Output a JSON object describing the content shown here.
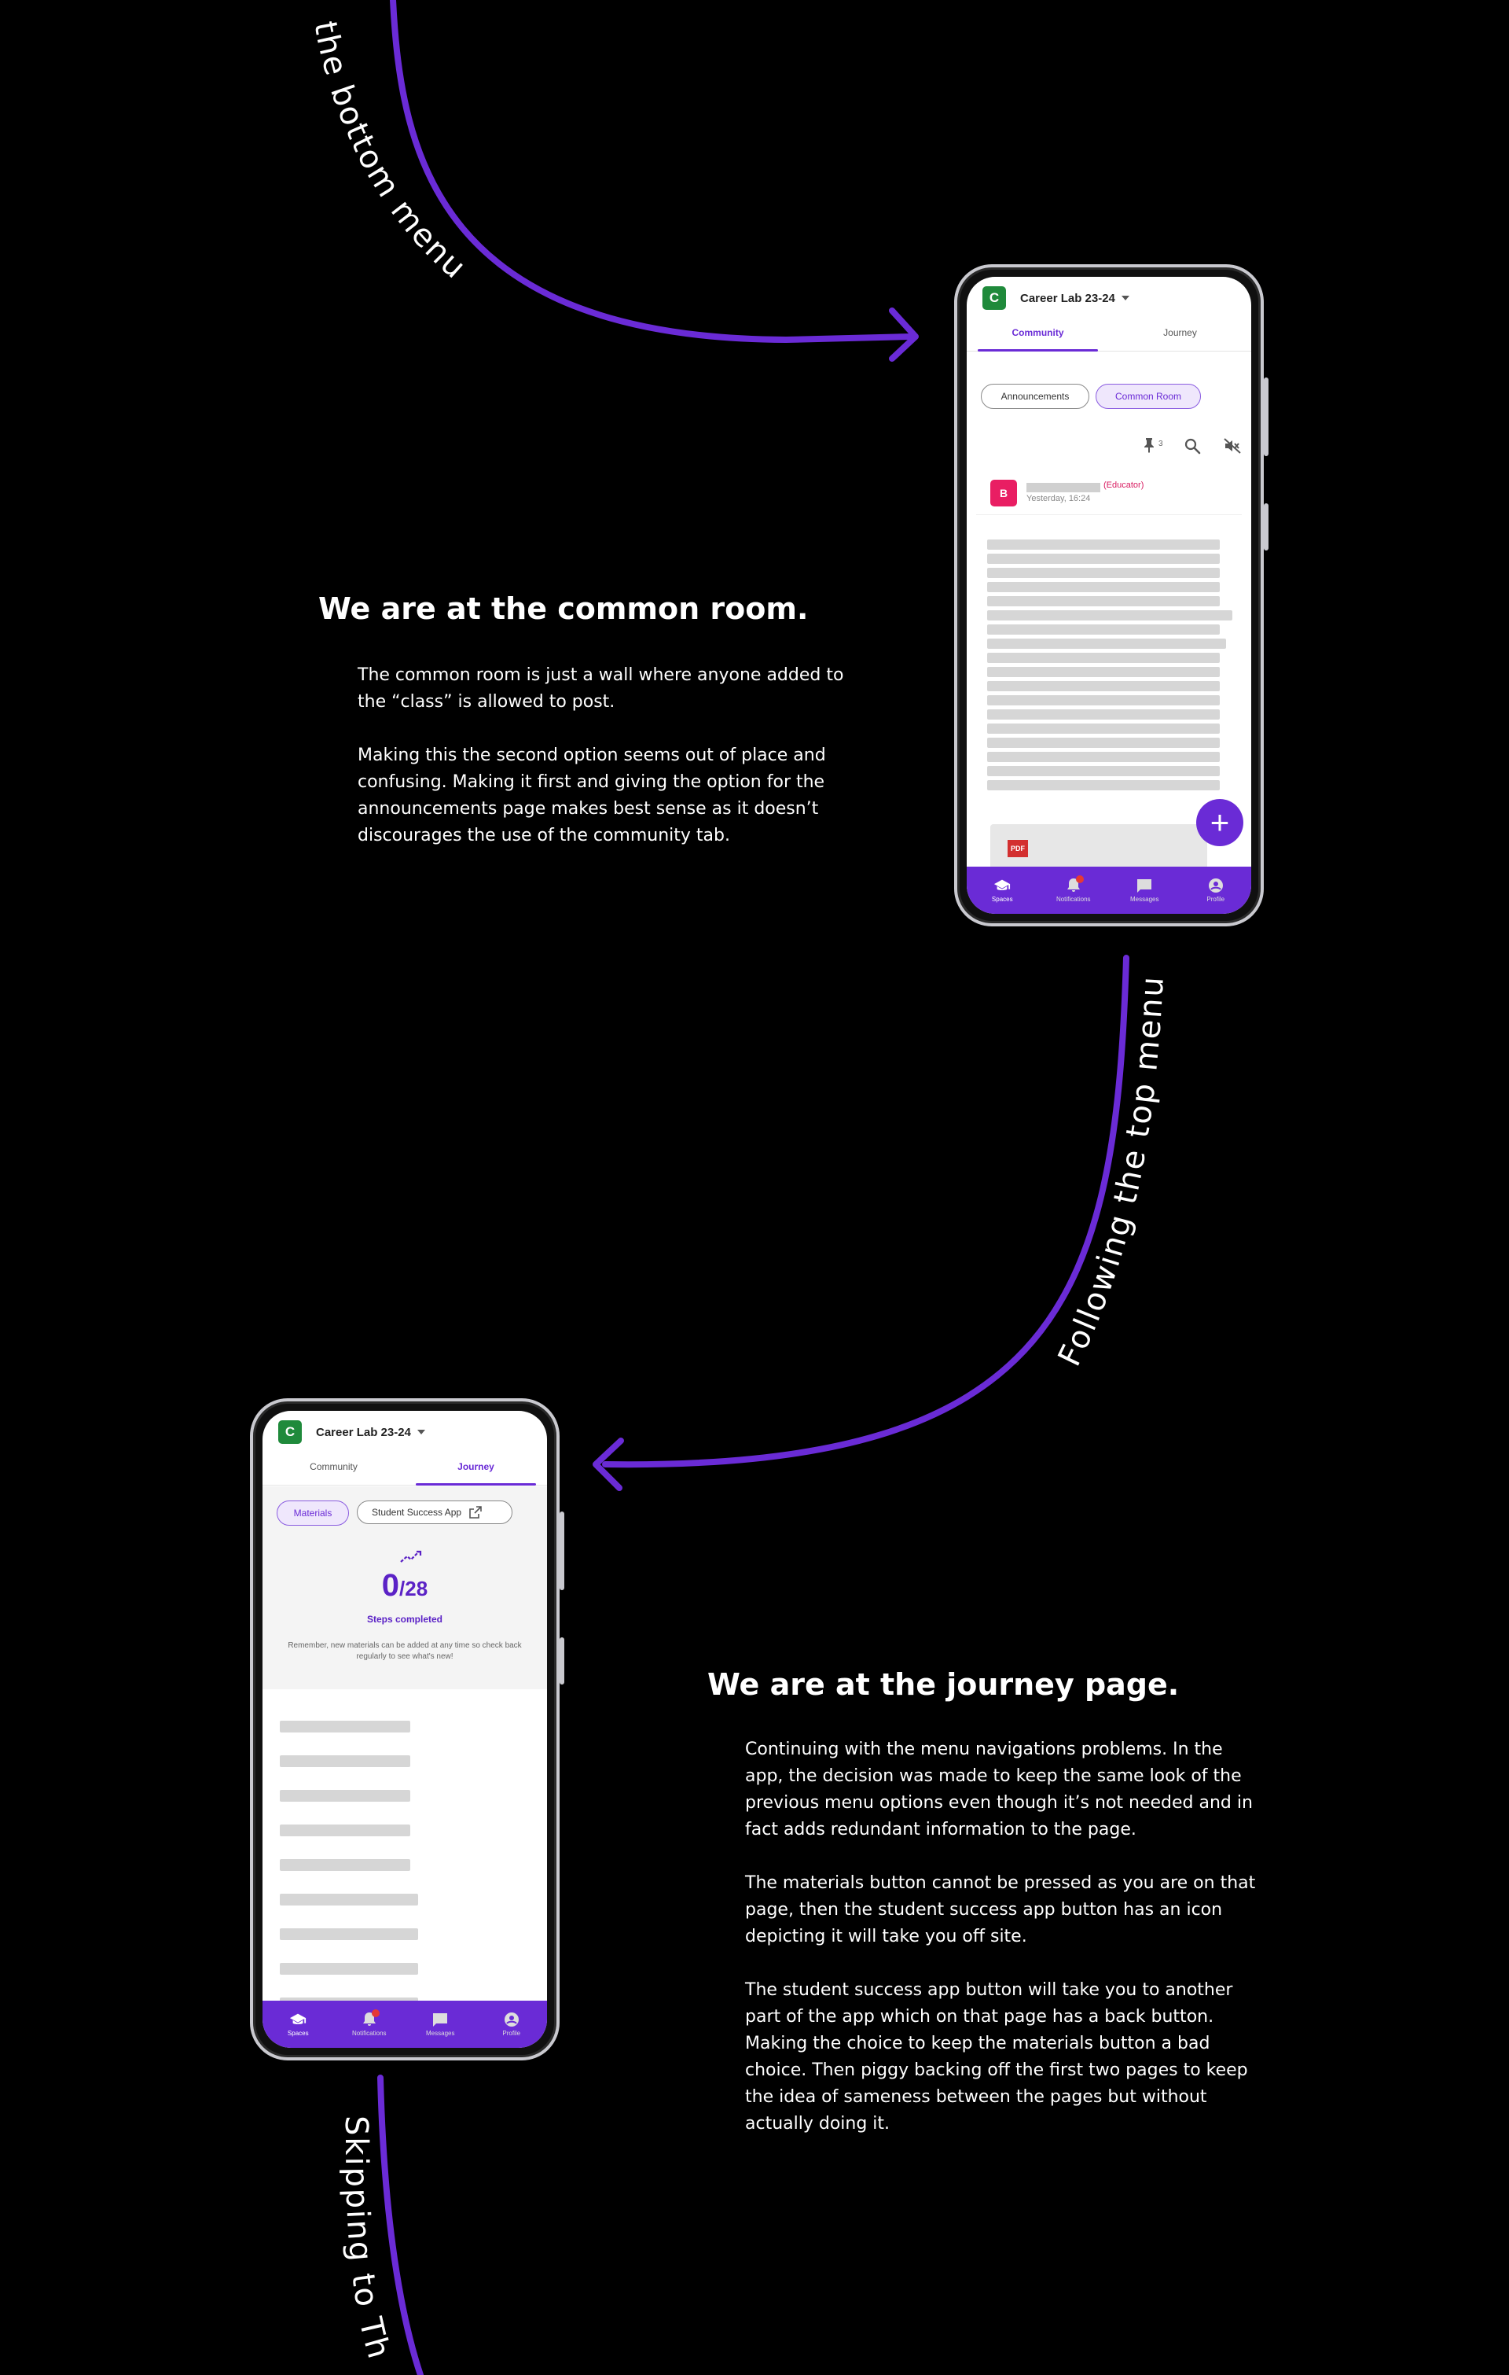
{
  "flow_labels": {
    "top_arc": "the  bottom  menu",
    "right_arc": "Following  the  top  menu",
    "bottom_arc": "Skipping  to  The"
  },
  "section1": {
    "heading": "We are at the common room.",
    "paragraphs": [
      "The common room is just a wall where anyone added to the “class” is allowed to post.",
      "Making this the second option seems out of place and confusing. Making it first and giving the option for the announcements  page makes best sense as it doesn’t discourages the use of the community tab."
    ]
  },
  "section2": {
    "heading": "We are at the journey page.",
    "paragraphs": [
      "Continuing with the menu navigations problems. In the app, the decision was made to keep the same look of the previous menu options even though it’s not needed and in fact adds redundant information to the page.",
      "The materials button cannot be pressed as you are on that page, then the student success app button has an icon depicting it will take you off site.",
      "The student success app button will take you to another part of the app which on that page has a back button. Making the choice to keep the materials button a bad choice. Then piggy backing off the first two pages to keep the idea of sameness between the pages but without actually doing it."
    ]
  },
  "phone1": {
    "space_avatar_letter": "C",
    "space_title": "Career Lab 23-24",
    "tabs": [
      "Community",
      "Journey"
    ],
    "active_tab": "Community",
    "chips": [
      "Announcements",
      "Common Room"
    ],
    "selected_chip": "Common Room",
    "pinned_count": "3",
    "post": {
      "avatar_letter": "B",
      "role": "(Educator)",
      "time": "Yesterday, 16:24"
    },
    "attachment_label": "PDF",
    "fab_label": "+",
    "bottom_nav": [
      "Spaces",
      "Notifications",
      "Messages",
      "Profile"
    ]
  },
  "phone2": {
    "space_avatar_letter": "C",
    "space_title": "Career Lab 23-24",
    "tabs": [
      "Community",
      "Journey"
    ],
    "active_tab": "Journey",
    "chips": [
      "Materials",
      "Student Success App"
    ],
    "selected_chip": "Materials",
    "steps_done": "0",
    "steps_total": "/28",
    "steps_label": "Steps completed",
    "note": "Remember, new materials can be added at any time so check back regularly to see what's new!",
    "bottom_nav": [
      "Spaces",
      "Notifications",
      "Messages",
      "Profile"
    ]
  },
  "colors": {
    "accent": "#6a2bd6",
    "arrow": "#6a2bd6",
    "background": "#000000",
    "space_avatar": "#1f8a3b",
    "post_avatar": "#e91e63",
    "notification_dot": "#e53935"
  },
  "icons": {
    "pin": "pin-icon",
    "search": "search-icon",
    "mute": "volume-off-icon",
    "external": "open-in-new-icon",
    "spaces": "graduation-cap-icon",
    "notifications": "bell-icon",
    "messages": "chat-icon",
    "profile": "account-circle-icon",
    "steps": "trend-icon"
  }
}
